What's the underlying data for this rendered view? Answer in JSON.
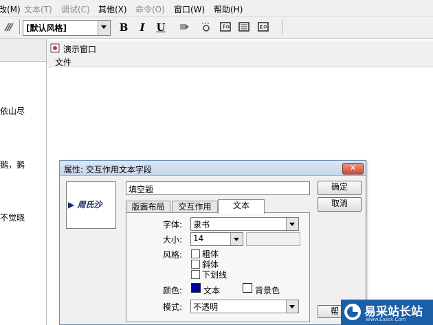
{
  "menubar": {
    "items": [
      {
        "label": "改(M)",
        "enabled": true
      },
      {
        "label": "文本(T)",
        "enabled": false
      },
      {
        "label": "调试(C)",
        "enabled": false
      },
      {
        "label": "其他(X)",
        "enabled": true
      },
      {
        "label": "命令(O)",
        "enabled": false
      },
      {
        "label": "窗口(W)",
        "enabled": true
      },
      {
        "label": "帮助(H)",
        "enabled": true
      }
    ]
  },
  "toolbar": {
    "style_combo_value": "[默认风格]",
    "bold_label": "B",
    "italic_label": "I",
    "underline_label": "U"
  },
  "left_panel": {
    "lines": [
      "依山尽",
      "鹅，鹅",
      "不觉晓"
    ]
  },
  "demo_window": {
    "title": "演示窗口",
    "menu_file": "文件"
  },
  "dialog": {
    "title": "属性: 交互作用文本字段",
    "close_label": "✕",
    "preview_text": "▶ 周氏沙",
    "field_name": "填空题",
    "ok_label": "确定",
    "cancel_label": "取消",
    "help_label": "帮",
    "tabs": [
      "版面布局",
      "交互作用",
      "文本"
    ],
    "active_tab": "文本",
    "font_label": "字体:",
    "font_value": "隶书",
    "size_label": "大小:",
    "size_value": "14",
    "style_label": "风格:",
    "style_options": [
      {
        "label": "粗体",
        "checked": false
      },
      {
        "label": "斜体",
        "checked": false
      },
      {
        "label": "下划线",
        "checked": false
      }
    ],
    "color_label": "颜色:",
    "text_color_label": "文本",
    "text_color": "#0000a8",
    "bg_color_label": "背景色",
    "bg_color": "#ffffff",
    "mode_label": "模式:",
    "mode_value": "不透明"
  },
  "watermark": {
    "brand_cn": "易采站长站",
    "brand_en": "Www.Easck.Com"
  }
}
